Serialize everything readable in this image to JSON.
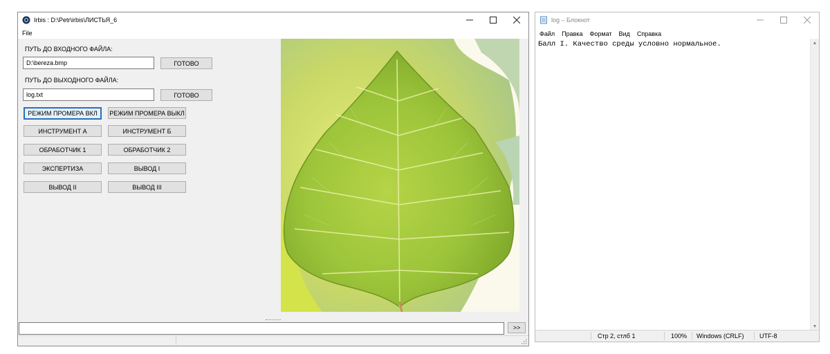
{
  "irbis": {
    "title": "Irbis : D:\\Petr\\irbis\\ЛИСТЬЯ_6",
    "menu": [
      "File"
    ],
    "input_label": "ПУТЬ ДО ВХОДНОГО ФАЙЛА:",
    "input_value": "D:\\bereza.bmp",
    "input_ready": "ГОТОВО",
    "output_label": "ПУТЬ ДО ВЫХОДНОГО ФАЙЛА:",
    "output_value": "log.txt",
    "output_ready": "ГОТОВО",
    "buttons": {
      "fit_on": "РЕЖИМ ПРОМЕРА ВКЛ",
      "fit_off": "РЕЖИМ ПРОМЕРА ВЫКЛ",
      "tool_a": "ИНСТРУМЕНТ А",
      "tool_b": "ИНСТРУМЕНТ Б",
      "proc_1": "ОБРАБОТЧИК 1",
      "proc_2": "ОБРАБОТЧИК 2",
      "expertise": "ЭКСПЕРТИЗА",
      "out_1": "ВЫВОД I",
      "out_2": "ВЫВОД II",
      "out_3": "ВЫВОД III"
    },
    "command_value": "",
    "send": ">>",
    "icons": {
      "app": "irbis-app-icon",
      "minimize": "minimize-icon",
      "maximize": "maximize-icon",
      "close": "close-icon"
    }
  },
  "notepad": {
    "title": "log – Блокнот",
    "menu": [
      "Файл",
      "Правка",
      "Формат",
      "Вид",
      "Справка"
    ],
    "text": "Балл I. Качество среды условно нормальное.",
    "status": {
      "position": "Стр 2, стлб 1",
      "zoom": "100%",
      "line_endings": "Windows (CRLF)",
      "encoding": "UTF-8"
    }
  },
  "colors": {
    "focus_border": "#2a6fba",
    "button_bg": "#e1e1e1",
    "leaf_green": "#9cc43a",
    "window_bg": "#f0f0f0"
  }
}
